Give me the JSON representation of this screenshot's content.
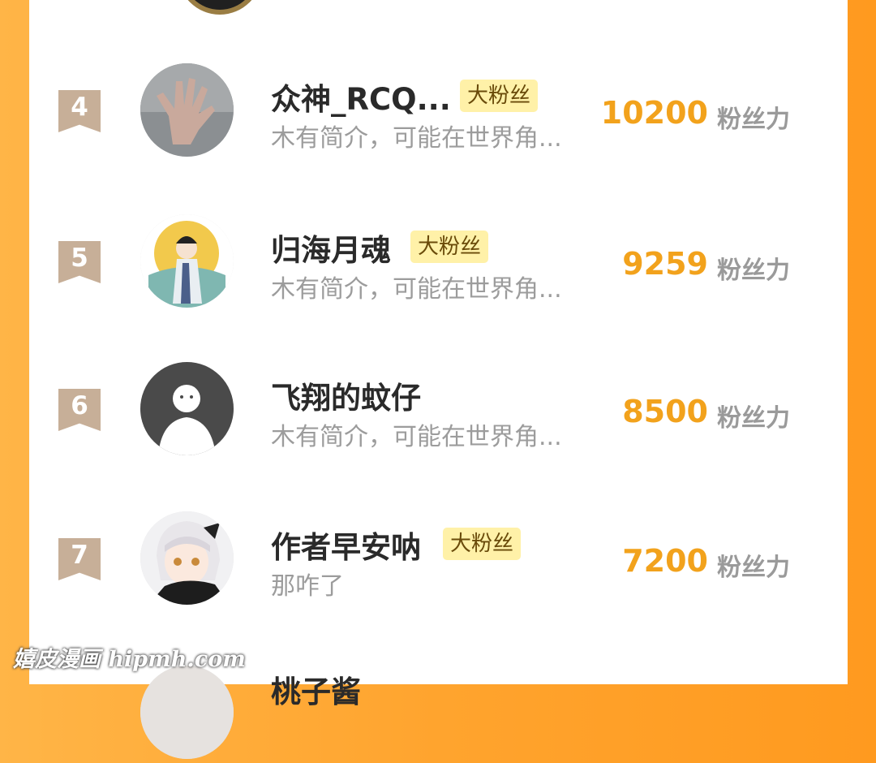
{
  "rows": [
    {
      "rank": "4",
      "name": "众神_RCQ...",
      "badge": "大粉丝",
      "bio": "木有简介，可能在世界角...",
      "score": "10200",
      "unit": "粉丝力"
    },
    {
      "rank": "5",
      "name": "归海月魂",
      "badge": "大粉丝",
      "bio": "木有简介，可能在世界角...",
      "score": "9259",
      "unit": "粉丝力"
    },
    {
      "rank": "6",
      "name": "飞翔的蚊仔",
      "badge": "",
      "bio": "木有简介，可能在世界角...",
      "score": "8500",
      "unit": "粉丝力"
    },
    {
      "rank": "7",
      "name": "作者早安呐",
      "badge": "大粉丝",
      "bio": "那咋了",
      "score": "7200",
      "unit": "粉丝力"
    },
    {
      "rank": "",
      "name": "桃子酱",
      "badge": "",
      "bio": "",
      "score": "",
      "unit": ""
    }
  ],
  "watermark": "嬉皮漫画 hipmh.com",
  "colors": {
    "accent": "#f2a21c",
    "badge_bg": "#fff1a8",
    "rank_bg": "#c7af98",
    "side_orange": "#ffa42e"
  }
}
